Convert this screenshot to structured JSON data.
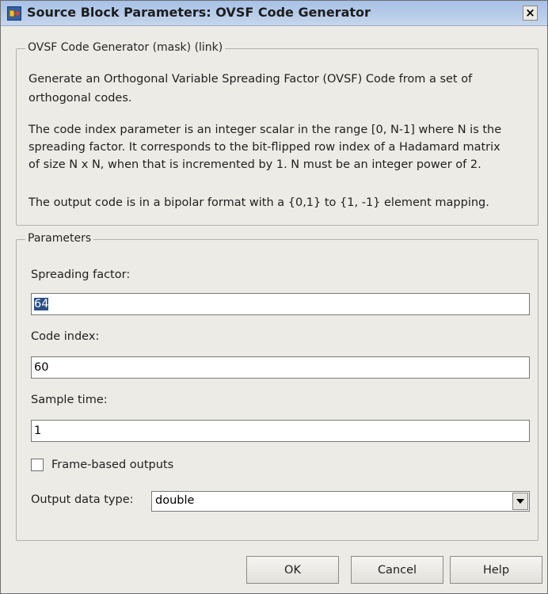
{
  "window": {
    "title": "Source Block Parameters: OVSF Code Generator",
    "close_glyph": "×"
  },
  "description_group": {
    "legend": "OVSF Code Generator (mask) (link)",
    "lines": [
      "Generate an Orthogonal Variable Spreading Factor (OVSF) Code from a set of",
      "orthogonal codes.",
      "The code index parameter is an integer scalar in the range [0, N-1] where N is the",
      "spreading factor.  It corresponds to the bit-flipped row index of a Hadamard matrix",
      "of size N x N, when that is incremented by 1. N must be an integer power of 2.",
      "The output code is in a bipolar format with a {0,1} to {1, -1} element mapping."
    ]
  },
  "parameters_group": {
    "legend": "Parameters",
    "spreading_factor": {
      "label": "Spreading factor:",
      "value": "64"
    },
    "code_index": {
      "label": "Code index:",
      "value": "60"
    },
    "sample_time": {
      "label": "Sample time:",
      "value": "1"
    },
    "frame_based": {
      "label": "Frame-based outputs",
      "checked": false
    },
    "output_data_type": {
      "label": "Output data type:",
      "value": "double"
    }
  },
  "buttons": {
    "ok": "OK",
    "cancel": "Cancel",
    "help": "Help"
  },
  "icons": {
    "title_icon": "simulink-block-icon",
    "dropdown_icon": "chevron-down-icon"
  },
  "colors": {
    "titlebar": "#b9cde9",
    "dialog_bg": "#ecebe6",
    "selection": "#2a4f85"
  }
}
